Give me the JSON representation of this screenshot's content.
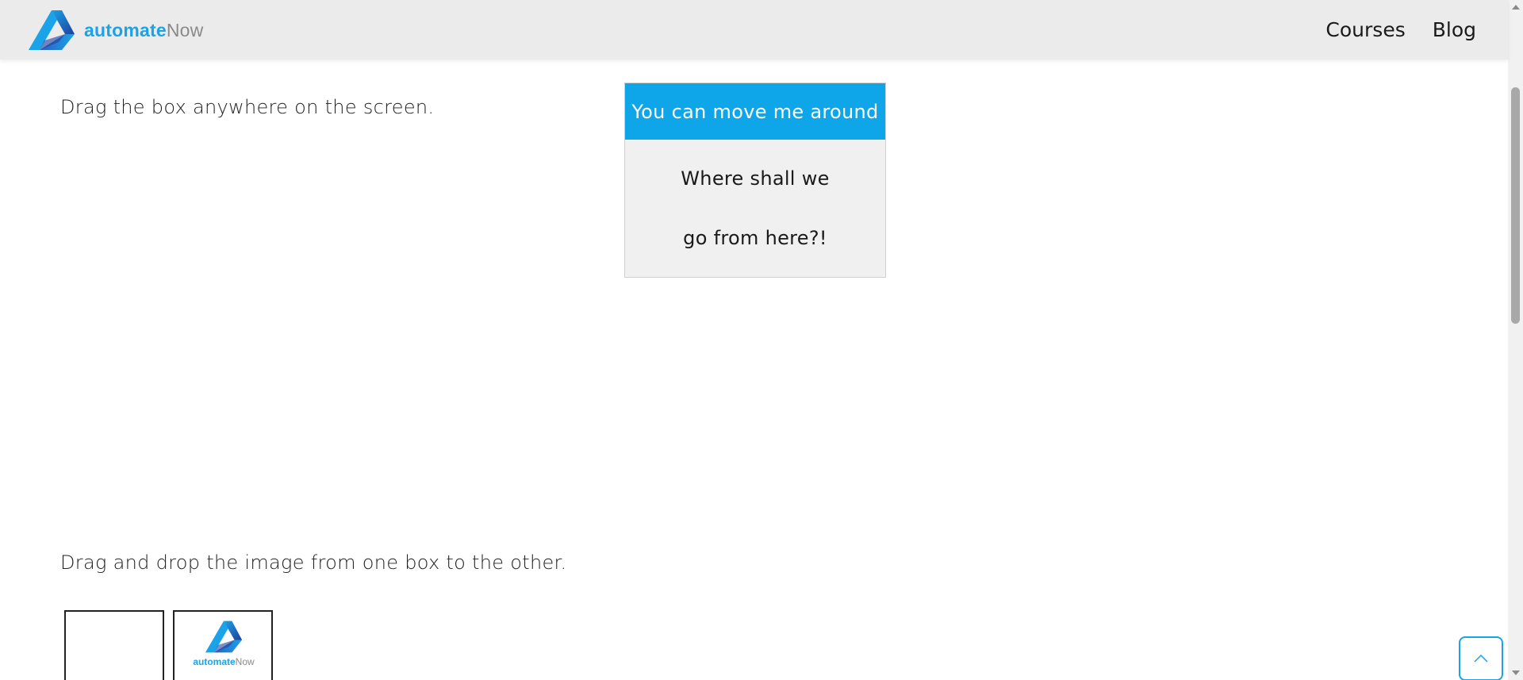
{
  "header": {
    "logo": {
      "bold": "automate",
      "light": "Now"
    },
    "nav": [
      {
        "label": "Courses"
      },
      {
        "label": "Blog"
      }
    ]
  },
  "main": {
    "drag_instruction": "Drag the box anywhere on the screen.",
    "draggable_box": {
      "handle_label": "You can move me around",
      "body_line_1": "Where shall we",
      "body_line_2": "go from here?!"
    },
    "dnd_instruction": "Drag and drop the image from one box to the other.",
    "drop_image_logo": {
      "bold": "automate",
      "light": "Now"
    }
  },
  "colors": {
    "accent": "#0ea5e9",
    "header_bg": "#ebebeb",
    "box_bg": "#f0f0f0"
  },
  "icons": {
    "back_to_top": "chevron-up-icon"
  }
}
